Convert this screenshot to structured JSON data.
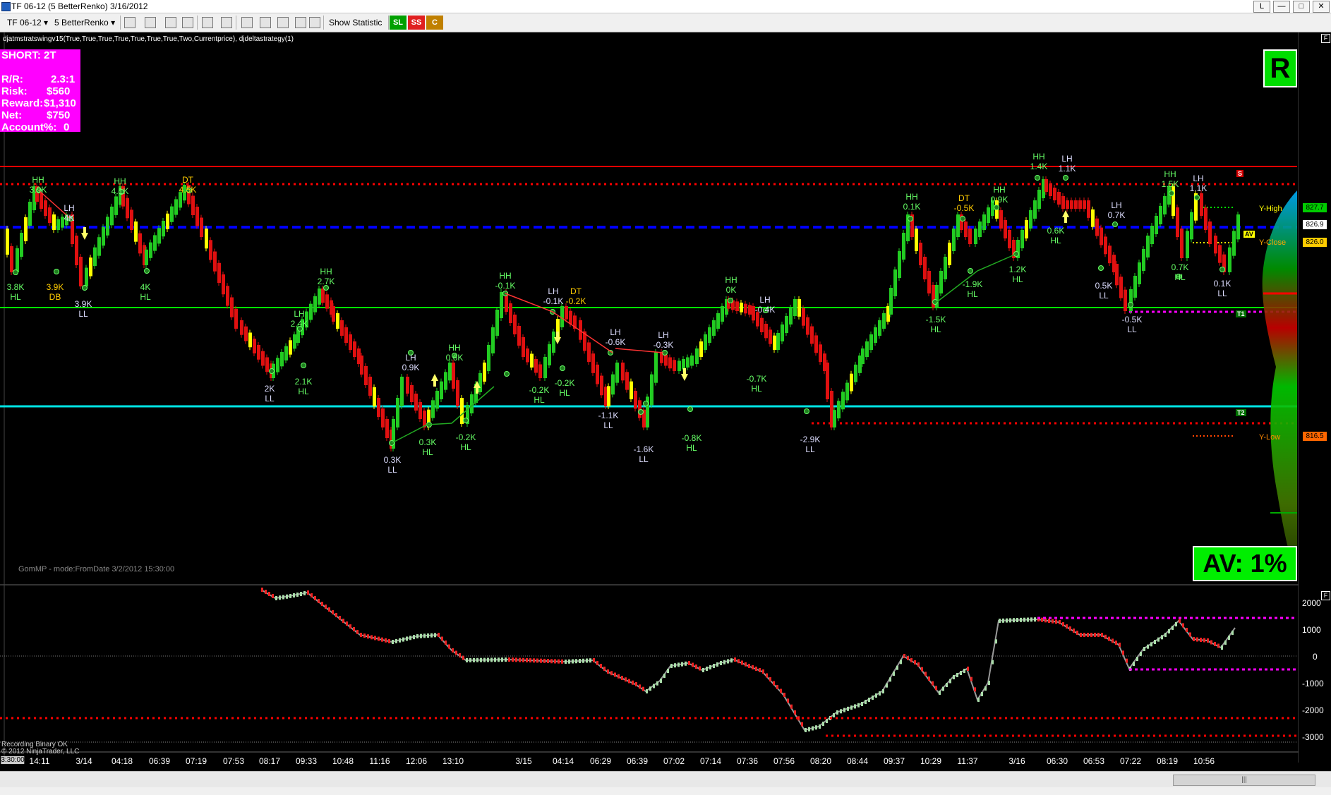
{
  "window": {
    "title": "TF 06-12 (5 BetterRenko)  3/16/2012",
    "buttons": [
      "L",
      "—",
      "□",
      "✕"
    ]
  },
  "toolbar": {
    "instrument": "TF 06-12",
    "bar_type": "5 BetterRenko",
    "show_statistic": "Show Statistic",
    "sl": "SL",
    "ss": "SS",
    "c": "C"
  },
  "indicator_header": "djatmstratswingv15(True,True,True,True,True,True,True,Two,Currentprice), djdeltastrategy(1)",
  "trade_box": {
    "title": "SHORT: 2T",
    "rr_label": "R/R:",
    "rr_value": "2.3:1",
    "risk_label": "Risk:",
    "risk_value": "$560",
    "reward_label": "Reward:",
    "reward_value": "$1,310",
    "net_label": "Net:",
    "net_value": "$750",
    "account_label": "Account%:",
    "account_value": "0"
  },
  "r_badge": "R",
  "av_badge": "AV: 1%",
  "gommp_text": "GomMP - mode:FromDate 3/2/2012 15:30:00",
  "copyright_lines": [
    "Recording Binary OK",
    "© 2012 NinjaTrader, LLC"
  ],
  "right_labels": {
    "y_high": "Y-High",
    "y_close": "Y-Close",
    "y_low": "Y-Low",
    "av": "AV",
    "s": "S",
    "t1": "T1",
    "t2": "T2"
  },
  "price_tags": {
    "y_high": "827.7",
    "current": "826.9",
    "y_close": "826.0",
    "y_low": "816.5"
  },
  "lower_panel_yaxis": [
    "2000",
    "1000",
    "0",
    "-1000",
    "-2000",
    "-3000"
  ],
  "x_axis": {
    "first": "3:30:00",
    "labels": [
      "14:11",
      "3/14",
      "04:18",
      "06:39",
      "07:19",
      "07:53",
      "08:17",
      "09:33",
      "10:48",
      "11:16",
      "12:06",
      "13:10",
      "3/15",
      "04:14",
      "06:29",
      "06:39",
      "07:02",
      "07:14",
      "07:36",
      "07:56",
      "08:20",
      "08:44",
      "09:37",
      "10:29",
      "11:37",
      "3/16",
      "06:30",
      "06:53",
      "07:22",
      "08:19",
      "10:56"
    ]
  },
  "swing_labels": [
    {
      "a": "HH",
      "b": "3.9K"
    },
    {
      "a": "LH",
      "b": "4K"
    },
    {
      "a": "HH",
      "b": "4.1K"
    },
    {
      "a": "DT",
      "b": "4.5K"
    },
    {
      "a": "3.8K",
      "b": "HL"
    },
    {
      "a": "3.9K",
      "b": "DB"
    },
    {
      "a": "3.9K",
      "b": "LL"
    },
    {
      "a": "4K",
      "b": "HL"
    },
    {
      "a": "HH",
      "b": "2.7K"
    },
    {
      "a": "LH",
      "b": "2.4K"
    },
    {
      "a": "2K",
      "b": "LL"
    },
    {
      "a": "2.1K",
      "b": "HL"
    },
    {
      "a": "LH",
      "b": "0.9K"
    },
    {
      "a": "HH",
      "b": "0.6K"
    },
    {
      "a": "0.3K",
      "b": "LL"
    },
    {
      "a": "0.3K",
      "b": "HL"
    },
    {
      "a": "-0.2K",
      "b": "HL"
    },
    {
      "a": "HH",
      "b": "-0.1K"
    },
    {
      "a": "LH",
      "b": "-0.1K"
    },
    {
      "a": "DT",
      "b": "-0.2K"
    },
    {
      "a": "-0.2K",
      "b": "HL"
    },
    {
      "a": "-0.2K",
      "b": "HL"
    },
    {
      "a": "LH",
      "b": "-0.6K"
    },
    {
      "a": "LH",
      "b": "-0.3K"
    },
    {
      "a": "-1.1K",
      "b": "LL"
    },
    {
      "a": "-1.6K",
      "b": "LL"
    },
    {
      "a": "-0.8K",
      "b": "HL"
    },
    {
      "a": "HH",
      "b": "0K"
    },
    {
      "a": "LH",
      "b": "-0.4K"
    },
    {
      "a": "-0.7K",
      "b": "HL"
    },
    {
      "a": "-2.9K",
      "b": "LL"
    },
    {
      "a": "HH",
      "b": "0.1K"
    },
    {
      "a": "DT",
      "b": "-0.5K"
    },
    {
      "a": "HH",
      "b": "0.9K"
    },
    {
      "a": "-1.5K",
      "b": "HL"
    },
    {
      "a": "-1.9K",
      "b": "HL"
    },
    {
      "a": "1.2K",
      "b": "HL"
    },
    {
      "a": "HH",
      "b": "1.4K"
    },
    {
      "a": "LH",
      "b": "1.1K"
    },
    {
      "a": "0.6K",
      "b": "HL"
    },
    {
      "a": "LH",
      "b": "0.7K"
    },
    {
      "a": "0.5K",
      "b": "LL"
    },
    {
      "a": "-0.5K",
      "b": "LL"
    },
    {
      "a": "HH",
      "b": "1.5K"
    },
    {
      "a": "LH",
      "b": "1.1K"
    },
    {
      "a": "0.7K",
      "b": "HL"
    },
    {
      "a": "0.1K",
      "b": "LL"
    }
  ],
  "colors": {
    "up_bar": "#22cc22",
    "down_bar": "#e01010",
    "neutral_bar": "#ffff00",
    "resistance": "#ff0000",
    "support_green": "#00ee00",
    "support_cyan": "#00e5e5",
    "blue_dash": "#0000ff",
    "magenta": "#ff00ff"
  }
}
